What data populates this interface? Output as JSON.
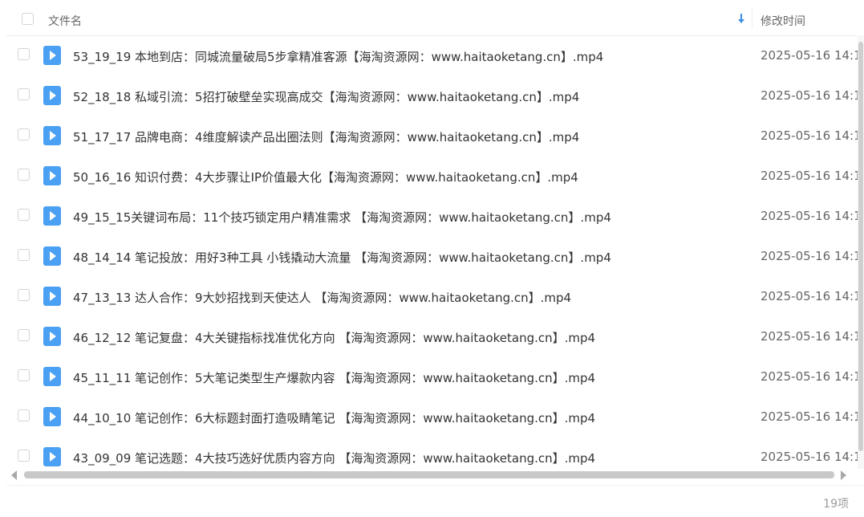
{
  "header": {
    "name_label": "文件名",
    "modified_label": "修改时间"
  },
  "files": [
    {
      "name": "53_19_19 本地到店：同城流量破局5步拿精准客源【海淘资源网：www.haitaoketang.cn】.mp4",
      "modified": "2025-05-16 14:1"
    },
    {
      "name": "52_18_18 私域引流：5招打破壁垒实现高成交【海淘资源网：www.haitaoketang.cn】.mp4",
      "modified": "2025-05-16 14:1"
    },
    {
      "name": "51_17_17 品牌电商：4维度解读产品出圈法则【海淘资源网：www.haitaoketang.cn】.mp4",
      "modified": "2025-05-16 14:1"
    },
    {
      "name": "50_16_16 知识付费：4大步骤让IP价值最大化【海淘资源网：www.haitaoketang.cn】.mp4",
      "modified": "2025-05-16 14:1"
    },
    {
      "name": "49_15_15关键词布局：11个技巧锁定用户精准需求 【海淘资源网：www.haitaoketang.cn】.mp4",
      "modified": "2025-05-16 14:1"
    },
    {
      "name": "48_14_14 笔记投放：用好3种工具 小钱撬动大流量 【海淘资源网：www.haitaoketang.cn】.mp4",
      "modified": "2025-05-16 14:1"
    },
    {
      "name": "47_13_13 达人合作：9大妙招找到天使达人 【海淘资源网：www.haitaoketang.cn】.mp4",
      "modified": "2025-05-16 14:1"
    },
    {
      "name": "46_12_12 笔记复盘：4大关键指标找准优化方向 【海淘资源网：www.haitaoketang.cn】.mp4",
      "modified": "2025-05-16 14:1"
    },
    {
      "name": "45_11_11 笔记创作：5大笔记类型生产爆款内容 【海淘资源网：www.haitaoketang.cn】.mp4",
      "modified": "2025-05-16 14:1"
    },
    {
      "name": "44_10_10 笔记创作：6大标题封面打造吸睛笔记 【海淘资源网：www.haitaoketang.cn】.mp4",
      "modified": "2025-05-16 14:1"
    },
    {
      "name": "43_09_09 笔记选题：4大技巧选好优质内容方向 【海淘资源网：www.haitaoketang.cn】.mp4",
      "modified": "2025-05-16 14:1"
    }
  ],
  "footer": {
    "item_count": "19项"
  },
  "icons": {
    "file": "video-file-icon",
    "sort": "sort-desc-arrow-icon"
  },
  "colors": {
    "accent": "#4aa0f2"
  }
}
